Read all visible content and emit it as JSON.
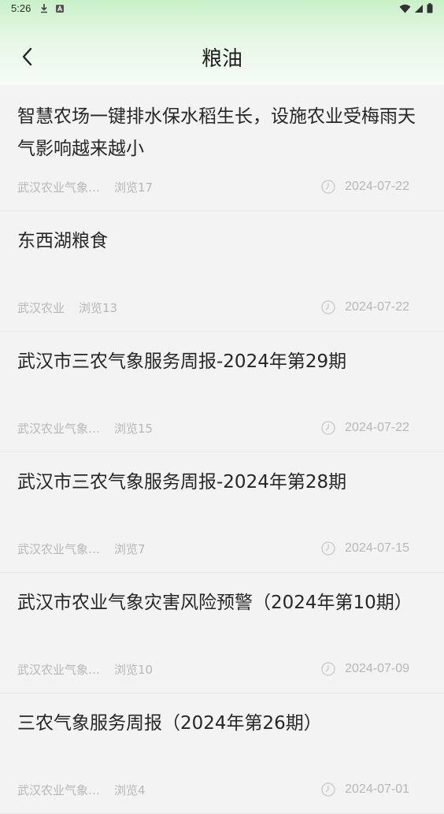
{
  "status_bar": {
    "time": "5:26",
    "icons": [
      "download-icon",
      "notification-a-icon",
      "wifi-icon",
      "signal-icon",
      "battery-icon"
    ]
  },
  "header": {
    "title": "粮油",
    "back_icon": "chevron-left-icon"
  },
  "articles": [
    {
      "title": "智慧农场一键排水保水稻生长，设施农业受梅雨天气影响越来越小",
      "source": "武汉农业气象…",
      "views": "浏览17",
      "date": "2024-07-22"
    },
    {
      "title": "东西湖粮食",
      "source": "武汉农业",
      "views": "浏览13",
      "date": "2024-07-22"
    },
    {
      "title": "武汉市三农气象服务周报-2024年第29期",
      "source": "武汉农业气象…",
      "views": "浏览15",
      "date": "2024-07-22"
    },
    {
      "title": "武汉市三农气象服务周报-2024年第28期",
      "source": "武汉农业气象…",
      "views": "浏览7",
      "date": "2024-07-15"
    },
    {
      "title": "武汉市农业气象灾害风险预警（2024年第10期）",
      "source": "武汉农业气象…",
      "views": "浏览10",
      "date": "2024-07-09"
    },
    {
      "title": "三农气象服务周报（2024年第26期）",
      "source": "武汉农业气象…",
      "views": "浏览4",
      "date": "2024-07-01"
    }
  ],
  "colors": {
    "header_gradient_top": "#c9f0c8",
    "background": "#f3f3f3",
    "meta_text": "#b7b7b7",
    "title_text": "#262626"
  }
}
